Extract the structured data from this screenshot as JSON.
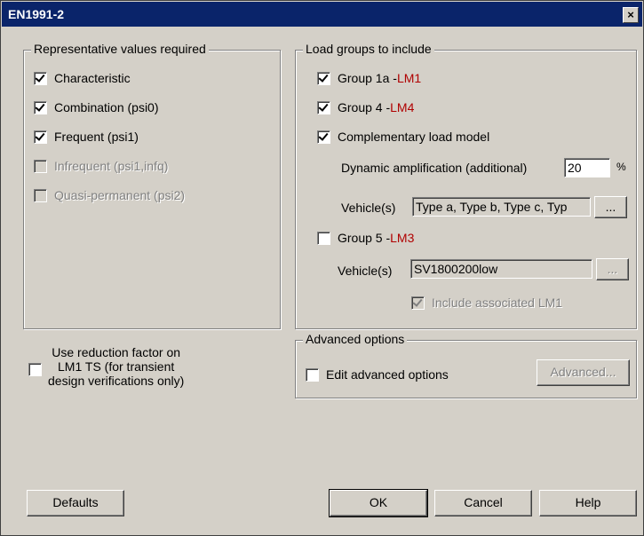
{
  "window": {
    "title": "EN1991-2",
    "close_glyph": "×"
  },
  "representative": {
    "legend": "Representative values required",
    "items": [
      {
        "label": "Characteristic",
        "checked": true,
        "enabled": true
      },
      {
        "label": "Combination (psi0)",
        "checked": true,
        "enabled": true
      },
      {
        "label": "Frequent (psi1)",
        "checked": true,
        "enabled": true
      },
      {
        "label": "Infrequent (psi1,infq)",
        "checked": false,
        "enabled": false
      },
      {
        "label": "Quasi-permanent (psi2)",
        "checked": false,
        "enabled": false
      }
    ]
  },
  "load_groups": {
    "legend": "Load groups to include",
    "group1a": {
      "prefix": "Group 1a - ",
      "model": "LM1",
      "checked": true
    },
    "group4": {
      "prefix": "Group 4 - ",
      "model": "LM4",
      "checked": true
    },
    "complementary": {
      "label": "Complementary load model",
      "checked": true
    },
    "dynamic_label": "Dynamic amplification (additional)",
    "dynamic_value": "20",
    "dynamic_unit": "%",
    "vehicles_label_1": "Vehicle(s)",
    "vehicles_value_1": "Type a, Type b, Type c, Typ",
    "browse_label": "...",
    "group5": {
      "prefix": "Group 5 - ",
      "model": "LM3",
      "checked": false
    },
    "vehicles_label_2": "Vehicle(s)",
    "vehicles_value_2": "SV1800200low",
    "include_lm1": {
      "label": "Include associated LM1",
      "checked": true,
      "enabled": false
    }
  },
  "reduction": {
    "line1": "Use reduction factor on",
    "line2": "LM1 TS (for transient",
    "line3": "design verifications only)",
    "checked": false
  },
  "advanced": {
    "legend": "Advanced options",
    "edit_label": "Edit advanced options",
    "edit_checked": false,
    "button_label": "Advanced..."
  },
  "buttons": {
    "defaults": "Defaults",
    "ok": "OK",
    "cancel": "Cancel",
    "help": "Help"
  }
}
